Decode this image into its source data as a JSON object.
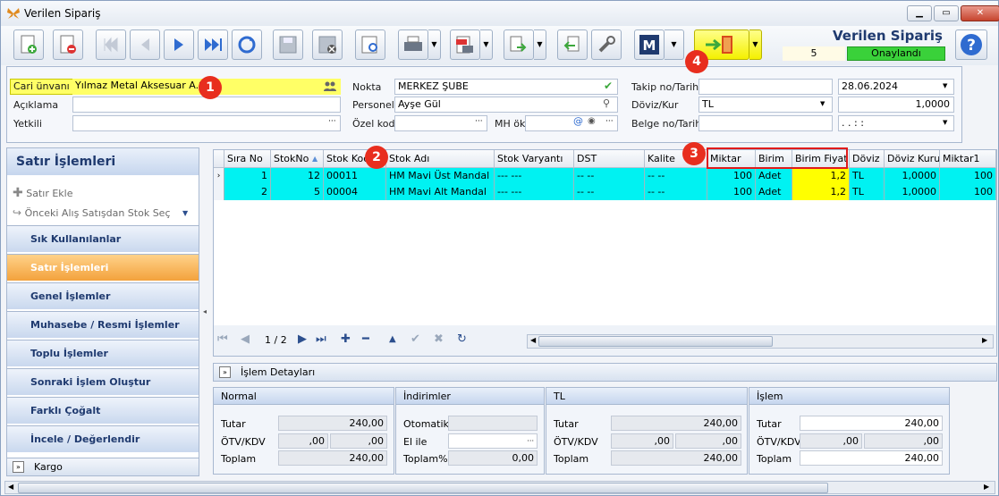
{
  "window": {
    "title": "Verilen Sipariş"
  },
  "header": {
    "title": "Verilen Sipariş",
    "doc_no": "5",
    "status": "Onaylandı"
  },
  "form": {
    "cari_label": "Cari ünvanı",
    "cari_value": "Yılmaz Metal Aksesuar A.Ş.",
    "aciklama_label": "Açıklama",
    "yetkili_label": "Yetkili",
    "nokta_label": "Nokta",
    "nokta_value": "MERKEZ ŞUBE",
    "personel_label": "Personel",
    "personel_value": "Ayşe Gül",
    "ozelkod_label": "Özel kod",
    "mhok_label": "MH ök",
    "takip_label": "Takip no/Tarih",
    "takip_date": "28.06.2024",
    "doviz_label": "Döviz/Kur",
    "doviz_value": "TL",
    "kur_value": "1,0000",
    "belge_label": "Belge no/Tarih",
    "belge_date": ". .   : :"
  },
  "badges": [
    "1",
    "2",
    "3",
    "4"
  ],
  "sidebar": {
    "title": "Satır İşlemleri",
    "actions": [
      "Satır Ekle",
      "Önceki Alış Satışdan Stok Seç"
    ],
    "items": [
      "Sık Kullanılanlar",
      "Satır İşlemleri",
      "Genel İşlemler",
      "Muhasebe / Resmi İşlemler",
      "Toplu İşlemler",
      "Sonraki İşlem Oluştur",
      "Farklı Çoğalt",
      "İncele / Değerlendir"
    ],
    "kargo": "Kargo"
  },
  "grid": {
    "columns": [
      "Sıra No",
      "StokNo",
      "Stok Kodu",
      "Stok Adı",
      "Stok Varyantı",
      "DST",
      "Kalite",
      "Miktar",
      "Birim",
      "Birim Fiyat",
      "Döviz",
      "Döviz Kuru",
      "Miktar1"
    ],
    "rows": [
      [
        "1",
        "12",
        "00011",
        "HM Mavi Üst Mandal",
        "--- ---",
        "-- --",
        "-- --",
        "100",
        "Adet",
        "1,2",
        "TL",
        "1,0000",
        "100"
      ],
      [
        "2",
        "5",
        "00004",
        "HM Mavi Alt Mandal",
        "--- ---",
        "-- --",
        "-- --",
        "100",
        "Adet",
        "1,2",
        "TL",
        "1,0000",
        "100"
      ]
    ],
    "pager": "1 / 2"
  },
  "details": {
    "bar_label": "İşlem Detayları",
    "normal": {
      "title": "Normal",
      "tutar_label": "Tutar",
      "tutar": "240,00",
      "otv_label": "ÖTV/KDV",
      "otv1": ",00",
      "otv2": ",00",
      "toplam_label": "Toplam",
      "toplam": "240,00"
    },
    "indirim": {
      "title": "İndirimler",
      "otomatik_label": "Otomatik",
      "elile_label": "El ile",
      "toplamyuzde_label": "Toplam%",
      "toplamyuzde": "0,00"
    },
    "tl": {
      "title": "TL",
      "tutar_label": "Tutar",
      "tutar": "240,00",
      "otv_label": "ÖTV/KDV",
      "otv1": ",00",
      "otv2": ",00",
      "toplam_label": "Toplam",
      "toplam": "240,00"
    },
    "islem": {
      "title": "İşlem",
      "tutar_label": "Tutar",
      "tutar": "240,00",
      "otv_label": "ÖTV/KDV",
      "otv1": ",00",
      "otv2": ",00",
      "toplam_label": "Toplam",
      "toplam": "240,00"
    }
  },
  "colors": {
    "highlight": "#ffff66",
    "row": "#00f2f2",
    "status": "#3ad13a",
    "badge": "#e82e1e"
  }
}
